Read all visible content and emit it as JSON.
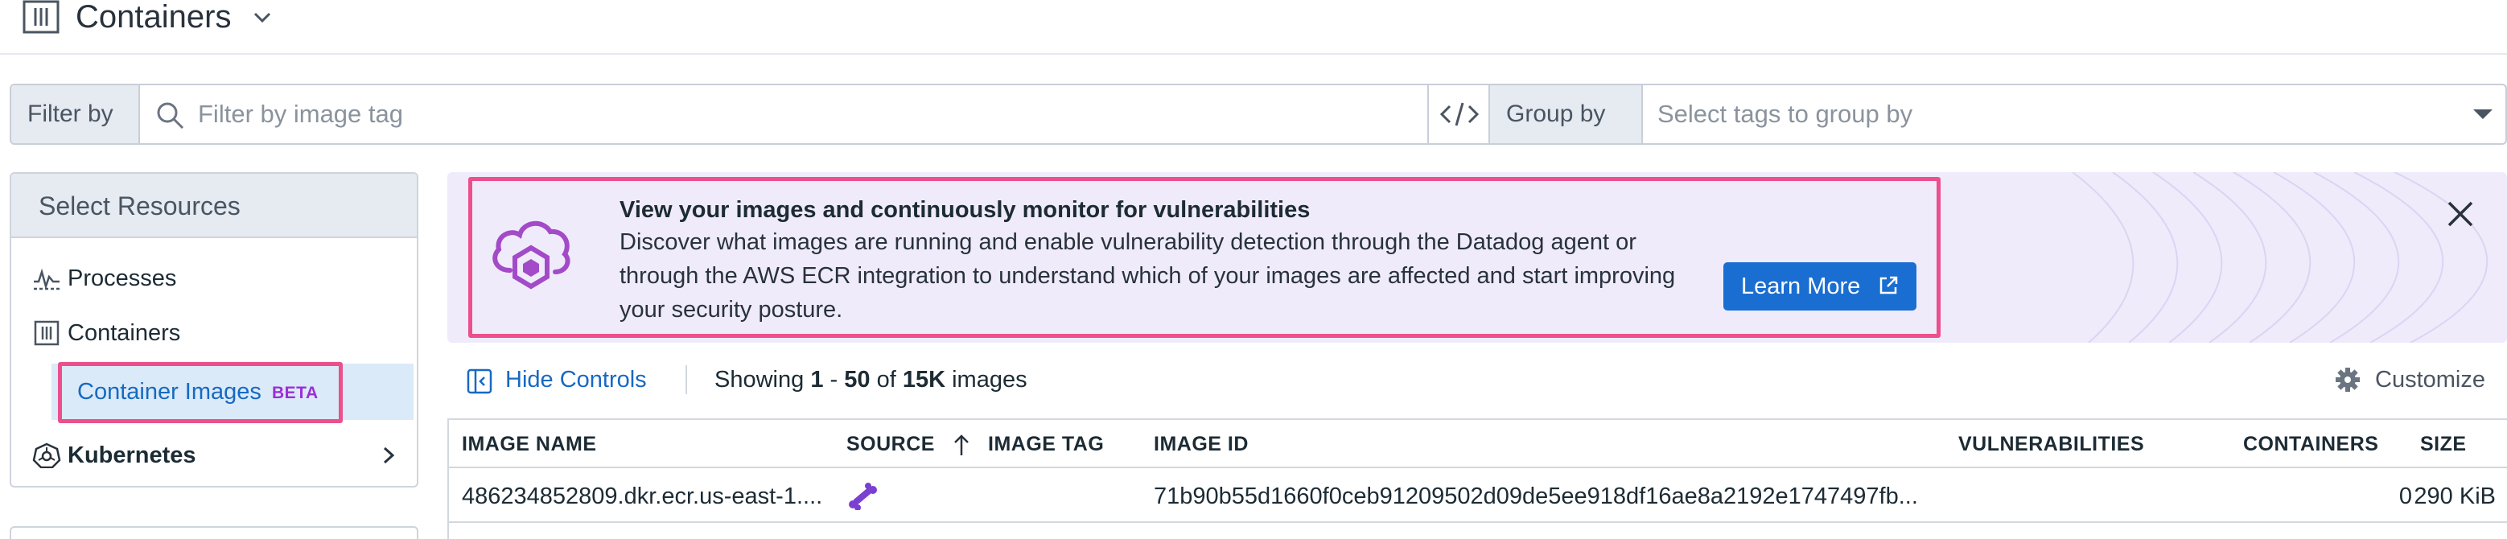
{
  "header": {
    "title": "Containers",
    "icon": "columns-icon",
    "dropdown_icon": "chevron-down-icon"
  },
  "filter_bar": {
    "filter_label": "Filter by",
    "filter_placeholder": "Filter by image tag",
    "group_label": "Group by",
    "group_placeholder": "Select tags to group by"
  },
  "sidebar": {
    "heading": "Select Resources",
    "items": [
      {
        "label": "Processes",
        "icon": "processes-icon"
      },
      {
        "label": "Containers",
        "icon": "columns-icon"
      },
      {
        "label": "Container Images",
        "badge": "BETA",
        "active": true
      },
      {
        "label": "Kubernetes",
        "icon": "kubernetes-icon",
        "expandable": true
      }
    ]
  },
  "banner": {
    "title": "View your images and continuously monitor for vulnerabilities",
    "body": "Discover what images are running and enable vulnerability detection through the Datadog agent or through the AWS ECR integration to understand which of your images are affected and start improving your security posture.",
    "button_label": "Learn More",
    "accent_color": "#1a6ed1",
    "highlight_color": "#ec4f8b"
  },
  "controls": {
    "hide_controls_label": "Hide Controls",
    "showing_prefix": "Showing",
    "range_start": "1",
    "range_sep": "-",
    "range_end": "50",
    "of_word": "of",
    "total": "15K",
    "suffix": "images",
    "customize_label": "Customize"
  },
  "table": {
    "columns": [
      "IMAGE NAME",
      "SOURCE",
      "IMAGE TAG",
      "IMAGE ID",
      "VULNERABILITIES",
      "CONTAINERS",
      "SIZE"
    ],
    "rows": [
      {
        "image_name": "486234852809.dkr.ecr.us-east-1....",
        "source_icon": "bone-icon",
        "image_tag": "",
        "image_id": "71b90b55d1660f0ceb91209502d09de5ee918df16ae8a2192e1747497fb...",
        "vulnerabilities": "",
        "containers": "0",
        "size": "290 KiB"
      }
    ]
  }
}
